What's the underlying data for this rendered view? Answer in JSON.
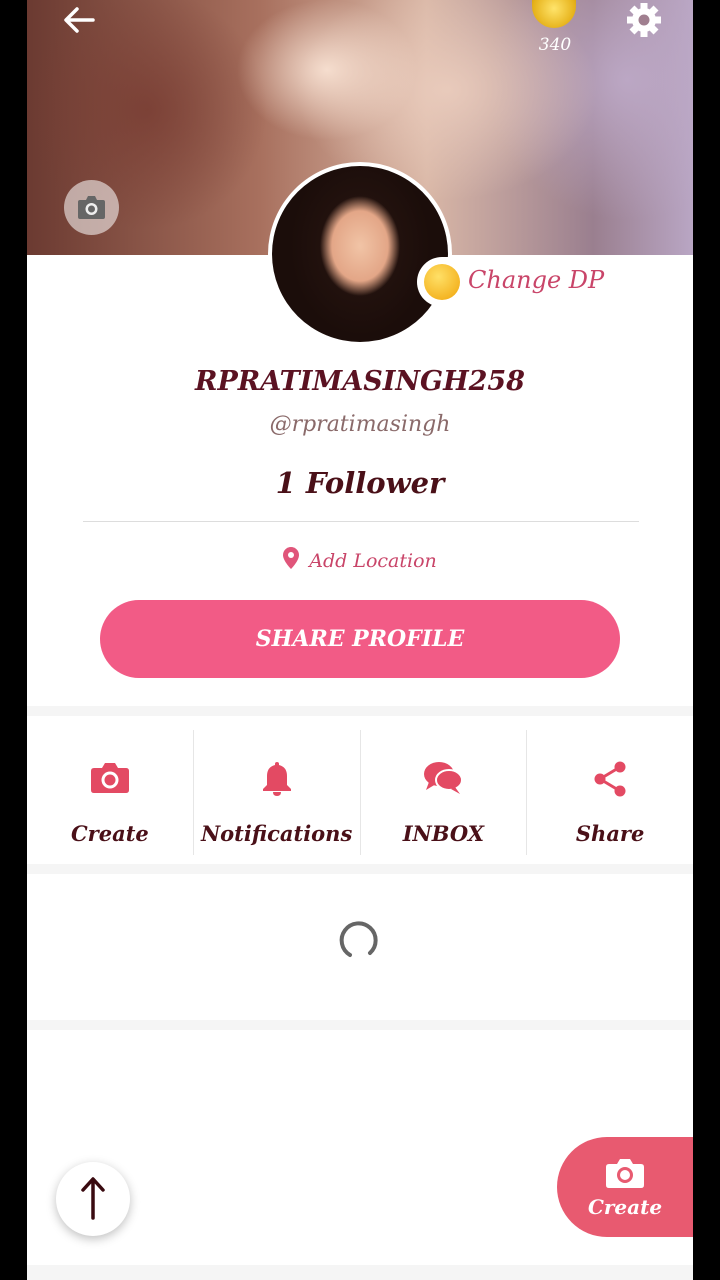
{
  "header": {
    "coins": "340",
    "icons": [
      "back-arrow-icon",
      "coin-icon",
      "gear-icon",
      "camera-icon"
    ]
  },
  "profile": {
    "change_dp_label": "Change DP",
    "name": "RPRATIMASINGH258",
    "handle": "@rpratimasingh",
    "followers": "1 Follower",
    "location_label": "Add Location",
    "share_profile_label": "SHARE PROFILE"
  },
  "actions": [
    {
      "label": "Create",
      "icon": "camera-icon"
    },
    {
      "label": "Notifications",
      "icon": "bell-icon"
    },
    {
      "label": "INBOX",
      "icon": "chat-bubbles-icon"
    },
    {
      "label": "Share",
      "icon": "share-icon"
    }
  ],
  "fab": {
    "label": "Create",
    "icon": "camera-icon"
  },
  "colors": {
    "accent": "#f25b86",
    "text_dark": "#4a1018",
    "accent_text": "#c94569"
  }
}
